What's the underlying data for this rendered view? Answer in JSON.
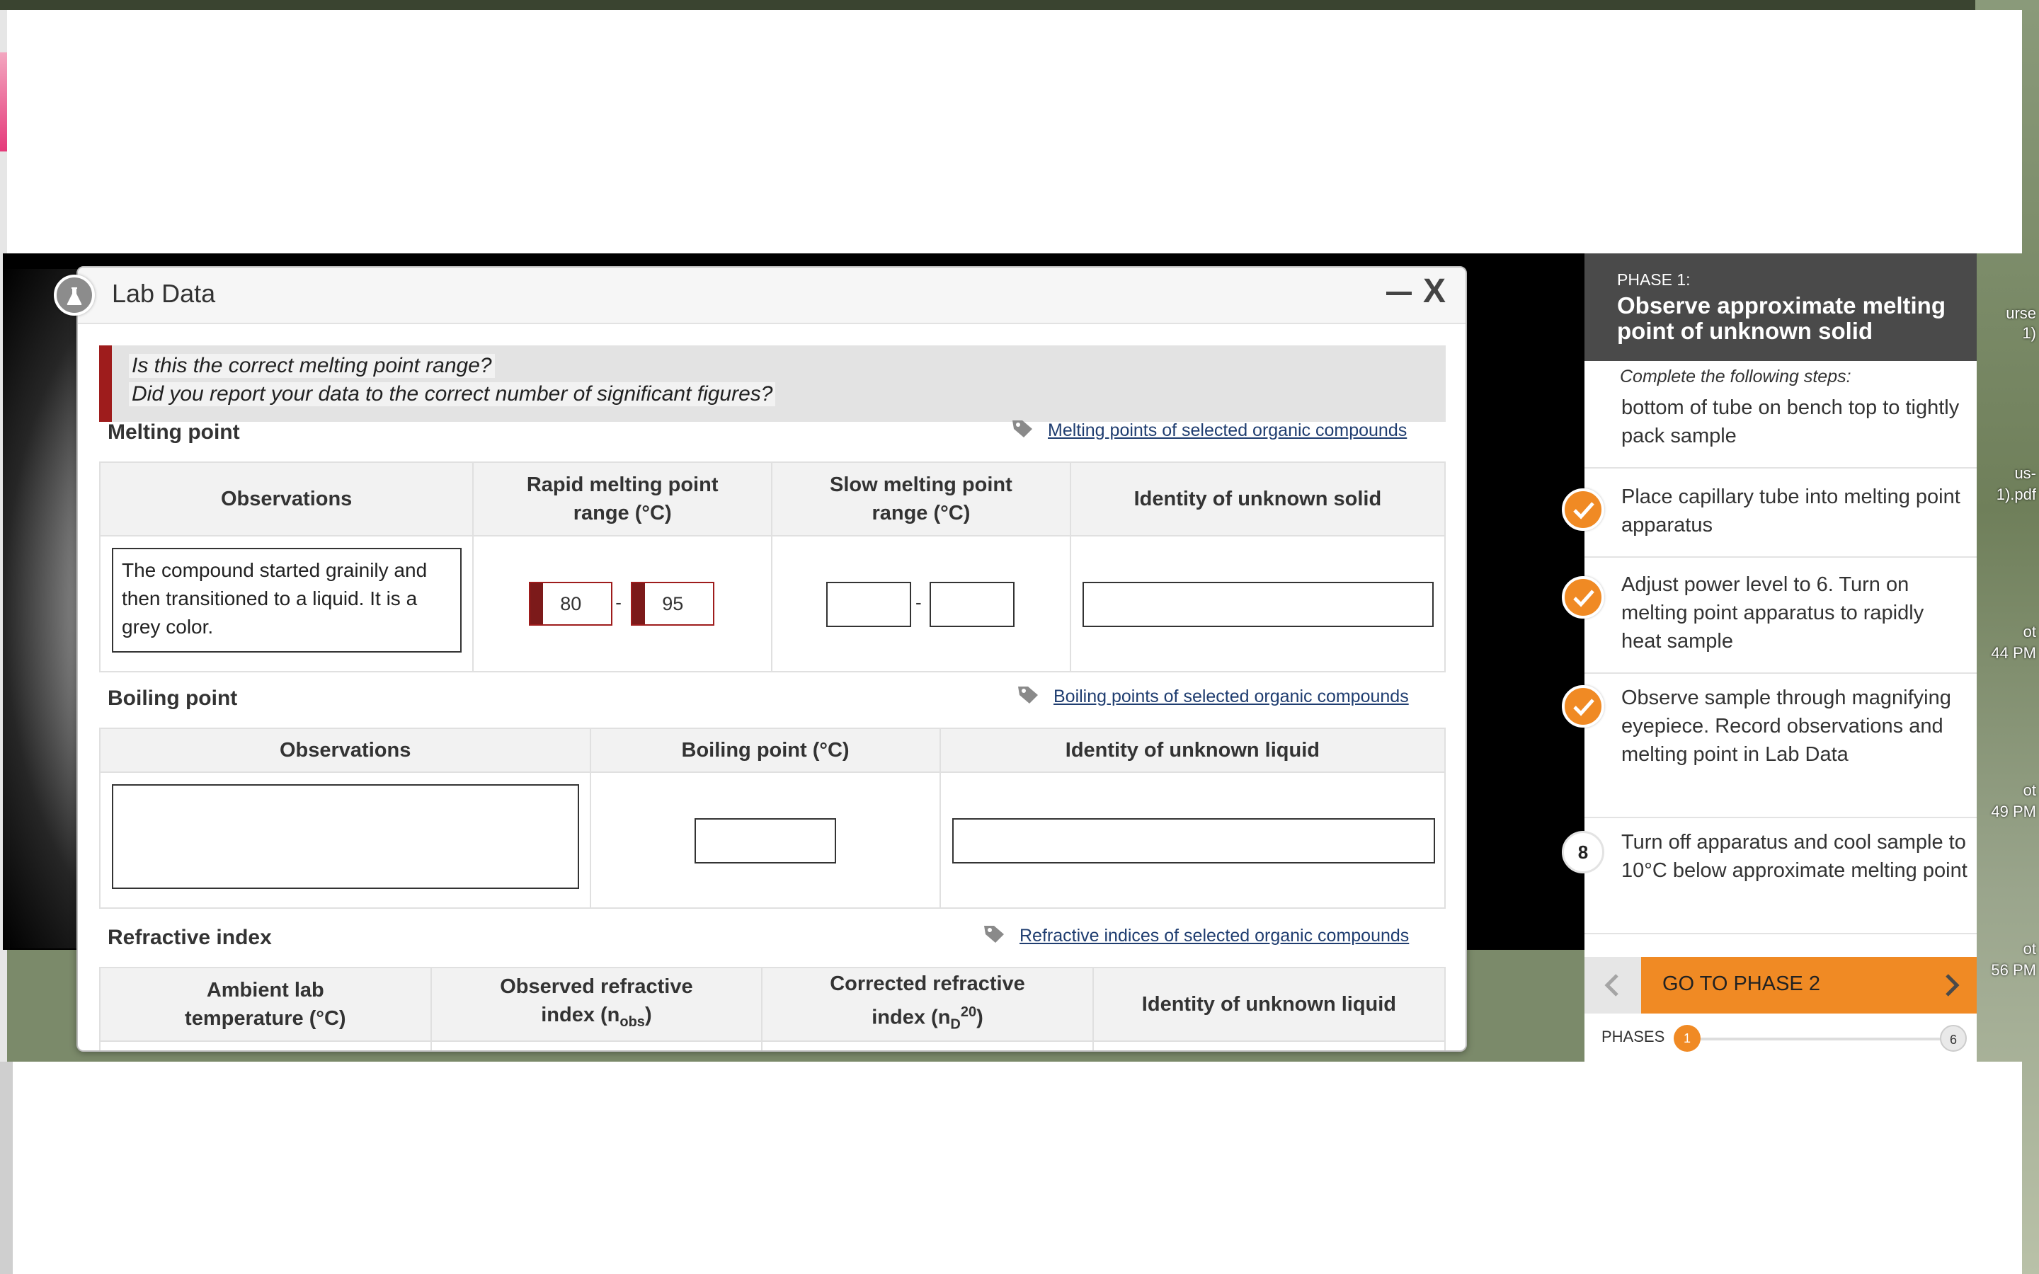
{
  "desktop": {
    "side_labels": [
      "urse",
      "1)",
      "us-",
      "1).pdf",
      "ot",
      "44 PM",
      "ot",
      "49 PM",
      "ot",
      "56 PM"
    ]
  },
  "lab_data": {
    "title": "Lab Data",
    "minimize_label": "—",
    "close_label": "X",
    "warning": {
      "line1": "Is this the correct melting point range?",
      "line2": "Did you report your data to the correct number of significant figures?"
    },
    "melting": {
      "title": "Melting point",
      "link": "Melting points of selected organic compounds",
      "headers": [
        "Observations",
        "Rapid melting point range (°C)",
        "Slow melting point range (°C)",
        "Identity of unknown solid"
      ],
      "observations": "The compound started grainily and then transitioned to a liquid. It is a grey color.",
      "rapid_low": "80",
      "rapid_high": "95",
      "separator": "-"
    },
    "boiling": {
      "title": "Boiling point",
      "link": "Boiling points of selected organic compounds",
      "headers": [
        "Observations",
        "Boiling point (°C)",
        "Identity of unknown liquid"
      ]
    },
    "refractive": {
      "title": "Refractive index",
      "link": "Refractive indices of selected organic compounds",
      "headers": {
        "ambient": "Ambient lab temperature (°C)",
        "observed": "Observed refractive index (n",
        "observed_sub": "obs",
        "corrected": "Corrected refractive index (n",
        "corrected_sub": "D",
        "corrected_sup": "20",
        "identity": "Identity of unknown liquid"
      }
    }
  },
  "phase_panel": {
    "phase_number": "PHASE 1:",
    "phase_name": "Observe approximate melting point of unknown solid",
    "steps_intro": "Complete the following steps:",
    "steps": [
      {
        "text": "bottom of tube on bench top to tightly pack sample",
        "status": "partial"
      },
      {
        "text": "Place capillary tube into melting point apparatus",
        "status": "done"
      },
      {
        "text": "Adjust power level to 6. Turn on melting point apparatus to rapidly heat sample",
        "status": "done"
      },
      {
        "text": "Observe sample through magnifying eyepiece. Record observations and melting point in Lab Data",
        "status": "done"
      },
      {
        "text": "Turn off apparatus and cool sample to 10°C below approximate melting point",
        "status": "pending",
        "number": "8"
      }
    ],
    "next_button": "GO TO PHASE 2",
    "phases_label": "PHASES",
    "phase_current": "1",
    "phase_total": "6",
    "accent_color": "#f08a24"
  }
}
